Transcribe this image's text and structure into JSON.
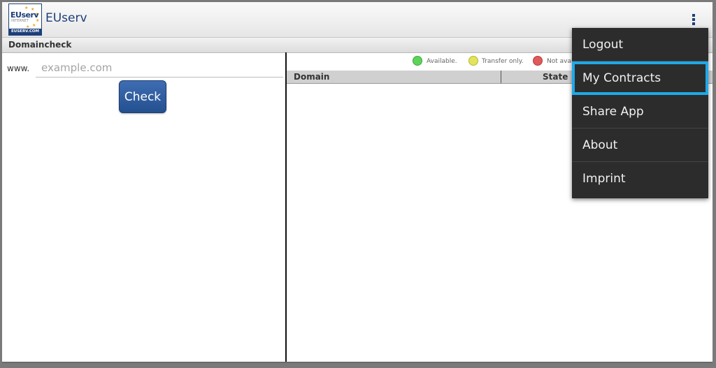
{
  "app": {
    "logo_text": "EUserv",
    "logo_sub": "INTERNET",
    "logo_bottom": "EUSERV.COM",
    "title": "EUserv"
  },
  "icons": {
    "overflow": "overflow-menu-icon"
  },
  "section": {
    "title": "Domaincheck"
  },
  "form": {
    "prefix": "www.",
    "input_value": "",
    "input_placeholder": "example.com",
    "check_label": "Check"
  },
  "legend": [
    {
      "label": "Available.",
      "color": "#5ed35a"
    },
    {
      "label": "Transfer only.",
      "color": "#e2e45a"
    },
    {
      "label": "Not avai",
      "color": "#e05a5a"
    }
  ],
  "table": {
    "columns": [
      "Domain",
      "State"
    ],
    "rows": []
  },
  "menu": {
    "items": [
      {
        "label": "Logout"
      },
      {
        "label": "My Contracts"
      },
      {
        "label": "Share App"
      },
      {
        "label": "About"
      },
      {
        "label": "Imprint"
      }
    ],
    "highlight_color": "#1ea9e8"
  },
  "colors": {
    "brand": "#1d3f7a",
    "button": "#2d5ca0",
    "menu_bg": "#2c2c2c"
  }
}
